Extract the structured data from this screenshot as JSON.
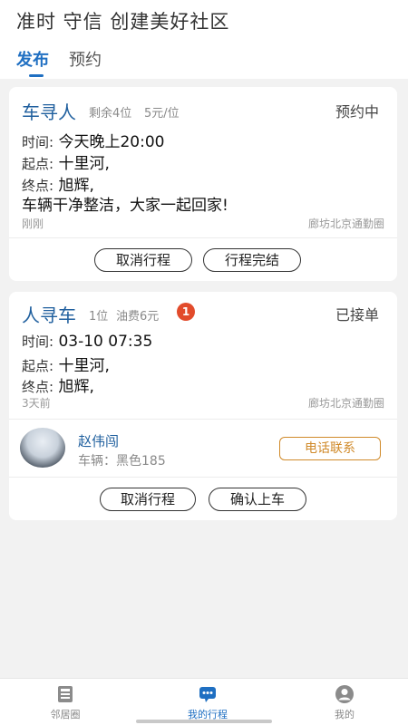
{
  "header": {
    "title": "准时 守信 创建美好社区",
    "tabs": [
      {
        "label": "发布",
        "active": true
      },
      {
        "label": "预约",
        "active": false
      }
    ]
  },
  "cards": [
    {
      "title": "车寻人",
      "meta_seats": "剩余4位",
      "meta_price": "5元/位",
      "status": "预约中",
      "time_label": "时间:",
      "time_value": "今天晚上20:00",
      "start_label": "起点:",
      "start_value": "十里河,",
      "end_label": "终点:",
      "end_value": "旭辉,",
      "note": "车辆干净整洁，大家一起回家!",
      "posted": "刚刚",
      "group": "廊坊北京通勤圈",
      "buttons": [
        "取消行程",
        "行程完结"
      ]
    },
    {
      "title": "人寻车",
      "meta_seats": "1位",
      "meta_price": "油费6元",
      "badge": "1",
      "status": "已接单",
      "time_label": "时间:",
      "time_value": "03-10 07:35",
      "start_label": "起点:",
      "start_value": "十里河,",
      "end_label": "终点:",
      "end_value": "旭辉,",
      "posted": "3天前",
      "group": "廊坊北京通勤圈",
      "driver": {
        "name": "赵伟闯",
        "vehicle": "车辆：黑色185",
        "call_label": "电话联系"
      },
      "buttons": [
        "取消行程",
        "确认上车"
      ]
    }
  ],
  "nav": {
    "items": [
      {
        "label": "邻居圈",
        "icon": "news-icon",
        "active": false
      },
      {
        "label": "我的行程",
        "icon": "trip-chat-icon",
        "active": true
      },
      {
        "label": "我的",
        "icon": "user-icon",
        "active": false
      }
    ]
  },
  "colors": {
    "accent": "#1f6fc2",
    "badge": "#e24b2b",
    "call": "#d08a2a"
  }
}
